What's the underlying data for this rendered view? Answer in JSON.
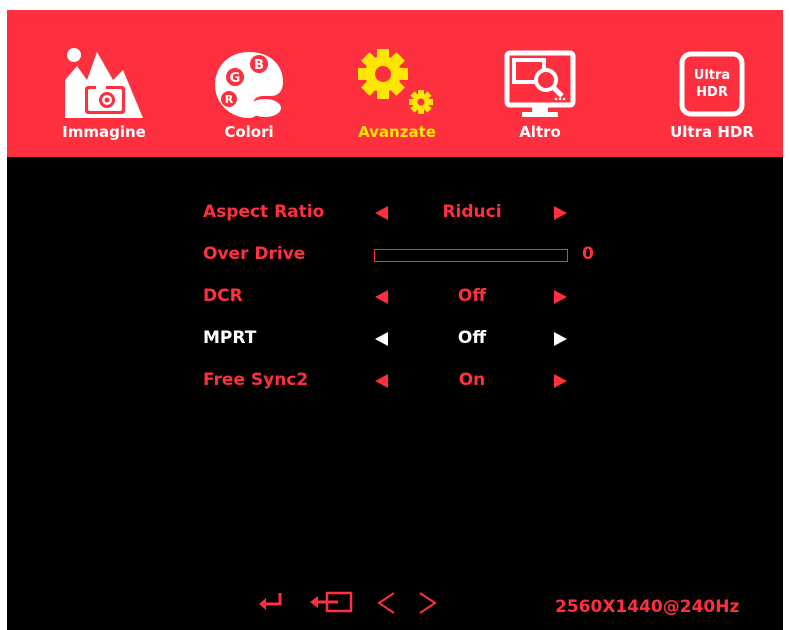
{
  "tabs": [
    {
      "label": "Immagine",
      "icon": "image-icon",
      "active": false
    },
    {
      "label": "Colori",
      "icon": "color-palette-icon",
      "active": false
    },
    {
      "label": "Avanzate",
      "icon": "gear-icon",
      "active": true
    },
    {
      "label": "Altro",
      "icon": "monitor-search-icon",
      "active": false
    },
    {
      "label": "Ultra HDR",
      "icon": "ultra-hdr-icon",
      "active": false
    }
  ],
  "palette_letters": {
    "b": "B",
    "g": "G",
    "r": "R"
  },
  "hdr_badge": {
    "line1": "Ultra",
    "line2": "HDR"
  },
  "settings": {
    "aspect_ratio": {
      "label": "Aspect Ratio",
      "value": "Riduci"
    },
    "over_drive": {
      "label": "Over Drive",
      "value": "0",
      "level": 0
    },
    "dcr": {
      "label": "DCR",
      "value": "Off"
    },
    "mprt": {
      "label": "MPRT",
      "value": "Off",
      "selected": true
    },
    "free_sync2": {
      "label": "Free Sync2",
      "value": "On"
    }
  },
  "footer": {
    "icons": [
      "enter-icon",
      "exit-icon",
      "left-icon",
      "right-icon"
    ],
    "resolution": "2560X1440@240Hz"
  },
  "colors": {
    "accent": "#fe2f3e",
    "highlight": "#ffe600",
    "background": "#000000",
    "text_selected": "#ffffff"
  }
}
